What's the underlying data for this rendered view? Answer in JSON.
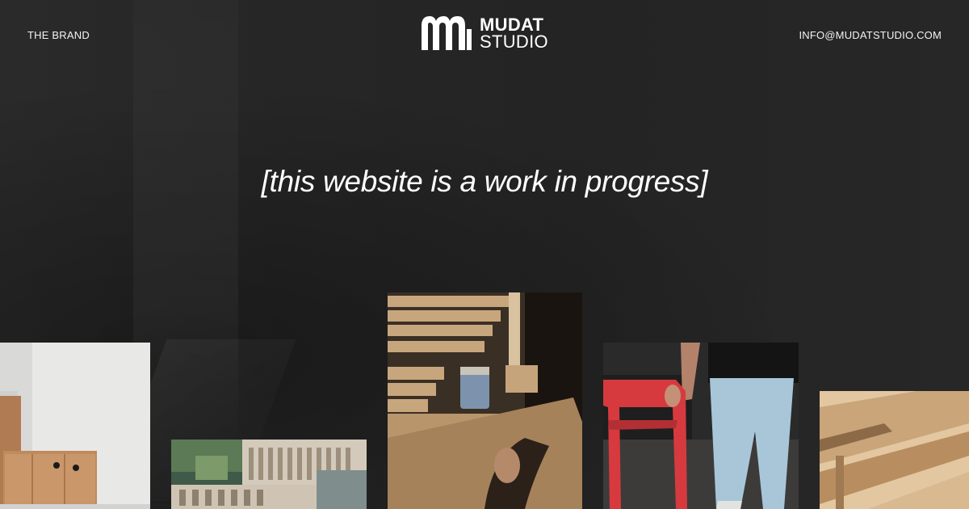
{
  "header": {
    "left_link": "THE BRAND",
    "logo_line1": "MUDAT",
    "logo_line2": "STUDIO",
    "right_link": "INFO@MUDATSTUDIO.COM"
  },
  "main": {
    "headline": "[this website is a work in progress]"
  },
  "colors": {
    "background": "#262626",
    "text": "#ffffff",
    "chair_red": "#d63a3f"
  },
  "gallery": {
    "photos": [
      "wood-cabinet-photo",
      "architectural-model-photo",
      "workshop-woodworking-photo",
      "red-chair-person-photo",
      "wooden-chair-detail-photo"
    ]
  }
}
